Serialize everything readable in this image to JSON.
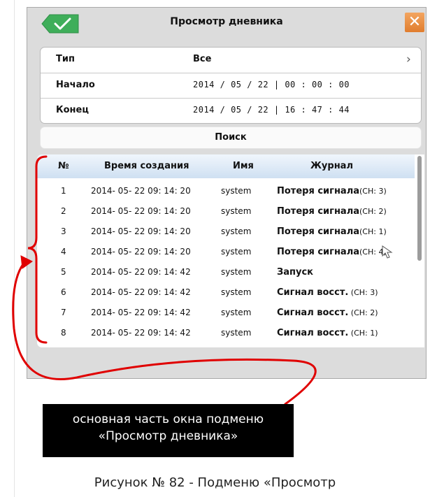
{
  "dialog": {
    "title": "Просмотр дневника",
    "close_glyph": "✕",
    "accent_ok": "#3fae5a",
    "accent_close": "#e8843a"
  },
  "form": {
    "type": {
      "label": "Тип",
      "value": "Все"
    },
    "start": {
      "label": "Начало",
      "value": "2014 / 05 / 22 |  00 :  00 :  00"
    },
    "end": {
      "label": "Конец",
      "value": "2014 / 05 / 22 |  16 :  47 :  44"
    },
    "chevron": "›"
  },
  "search_label": "Поиск",
  "table": {
    "headers": {
      "no": "№",
      "time": "Время создания",
      "name": "Имя",
      "journal": "Журнал"
    },
    "rows": [
      {
        "no": "1",
        "time": "2014- 05- 22  09: 14: 20",
        "name": "system",
        "journal": "Потеря сигнала",
        "ch": "(CH: 3)"
      },
      {
        "no": "2",
        "time": "2014- 05- 22  09: 14: 20",
        "name": "system",
        "journal": "Потеря сигнала",
        "ch": "(CH: 2)"
      },
      {
        "no": "3",
        "time": "2014- 05- 22  09: 14: 20",
        "name": "system",
        "journal": "Потеря сигнала",
        "ch": "(CH: 1)"
      },
      {
        "no": "4",
        "time": "2014- 05- 22  09: 14: 20",
        "name": "system",
        "journal": "Потеря сигнала",
        "ch": "(CH: 4)"
      },
      {
        "no": "5",
        "time": "2014- 05- 22  09: 14: 42",
        "name": "system",
        "journal": "Запуск",
        "ch": ""
      },
      {
        "no": "6",
        "time": "2014- 05- 22  09: 14: 42",
        "name": "system",
        "journal": "Сигнал восст.",
        "ch": " (CH: 3)"
      },
      {
        "no": "7",
        "time": "2014- 05- 22  09: 14: 42",
        "name": "system",
        "journal": "Сигнал восст.",
        "ch": " (CH: 2)"
      },
      {
        "no": "8",
        "time": "2014- 05- 22  09: 14: 42",
        "name": "system",
        "journal": "Сигнал восст.",
        "ch": " (CH: 1)"
      }
    ]
  },
  "annotation": {
    "line1": "основная часть окна подменю",
    "line2": "«Просмотр дневника»",
    "color": "#e00000"
  },
  "caption": "Рисунок № 82 - Подменю «Просмотр"
}
